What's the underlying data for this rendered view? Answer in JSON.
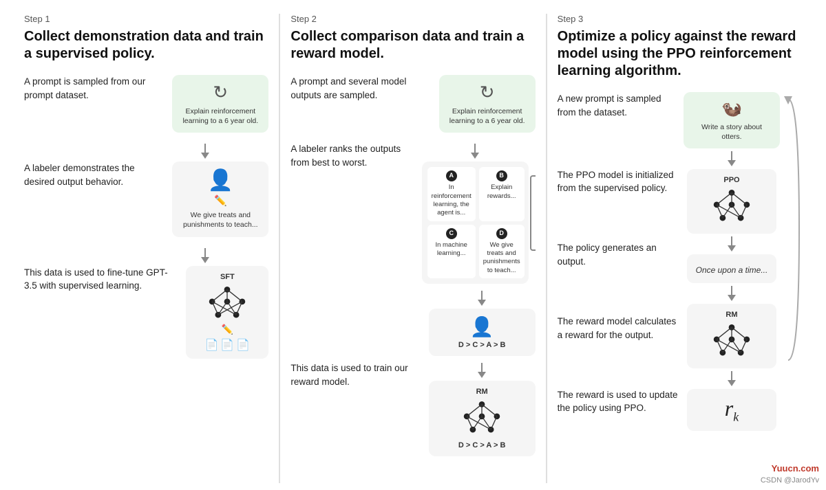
{
  "steps": [
    {
      "label": "Step 1",
      "title": "Collect demonstration data and train a supervised policy.",
      "rows": [
        {
          "text": "A prompt is sampled from our prompt dataset.",
          "card_type": "green",
          "card_content": "prompt",
          "card_label": "Explain reinforcement learning to a 6 year old."
        },
        {
          "text": "A labeler demonstrates the desired output behavior.",
          "card_type": "gray",
          "card_content": "person_pencil",
          "card_label": "We give treats and punishments to teach..."
        },
        {
          "text": "This data is used to fine-tune GPT-3.5 with supervised learning.",
          "card_type": "gray",
          "card_content": "network_sft",
          "card_label": "SFT"
        }
      ]
    },
    {
      "label": "Step 2",
      "title": "Collect comparison data and train a reward model.",
      "rows": [
        {
          "text": "A prompt and several model outputs are sampled.",
          "card_type": "green",
          "card_label": "Explain reinforcement learning to a 6 year old."
        },
        {
          "text": "A labeler ranks the outputs from best to worst.",
          "card_type": "gray",
          "card_content": "comparison_grid",
          "ranking": "D > C > A > B"
        },
        {
          "text": "This data is used to train our reward model.",
          "card_type": "gray",
          "card_content": "network_rm",
          "ranking": "D > C > A > B"
        }
      ],
      "comp_cells": [
        {
          "label": "A",
          "text": "In reinforcement learning, the agent is..."
        },
        {
          "label": "B",
          "text": "Explain rewards..."
        },
        {
          "label": "C",
          "text": "In machine learning..."
        },
        {
          "label": "D",
          "text": "We give treats and punishments to teach..."
        }
      ]
    },
    {
      "label": "Step 3",
      "title": "Optimize a policy against the reward model using the PPO reinforcement learning algorithm.",
      "rows": [
        {
          "text": "A new prompt is sampled from the dataset.",
          "card_type": "green",
          "card_label": "Write a story about otters."
        },
        {
          "text": "The PPO model is initialized from the supervised policy.",
          "card_type": "gray",
          "card_content": "network_ppo",
          "card_label": "PPO"
        },
        {
          "text": "The policy generates an output.",
          "card_type": "gray",
          "card_content": "text_box",
          "card_label": "Once upon a time..."
        },
        {
          "text": "The reward model calculates a reward for the output.",
          "card_type": "gray",
          "card_content": "network_rm2",
          "card_label": "RM"
        },
        {
          "text": "The reward is used to update the policy using PPO.",
          "card_type": "gray",
          "card_content": "rk",
          "card_label": "rk"
        }
      ]
    }
  ],
  "watermark": "CSDN @JarodYv",
  "watermark_red": "Yuucn.com"
}
